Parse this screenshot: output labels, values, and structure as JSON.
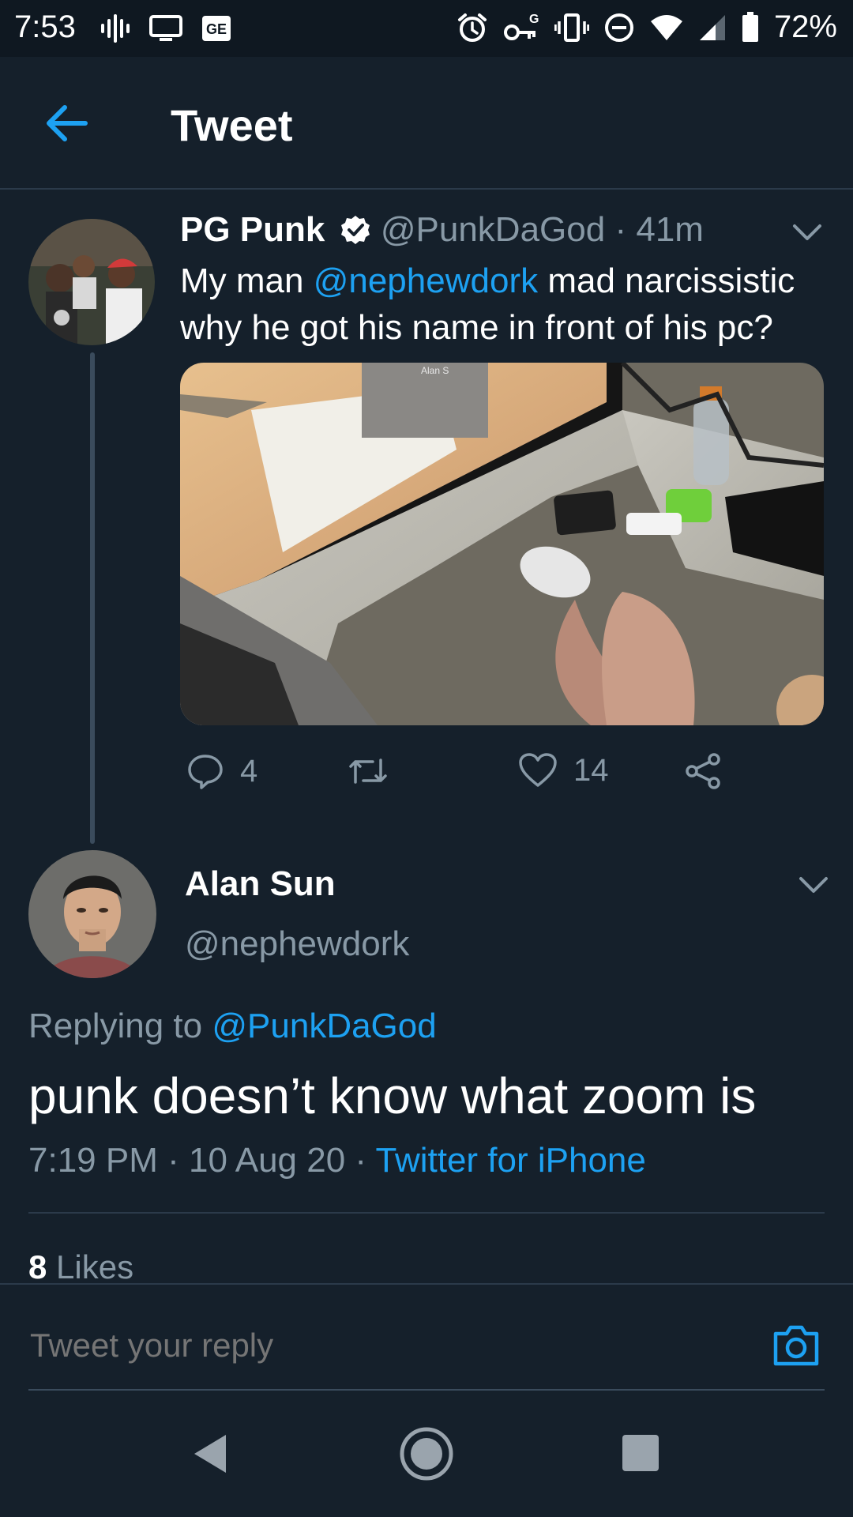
{
  "status_bar": {
    "time": "7:53",
    "battery": "72%",
    "icons_left": [
      "podcast-icon",
      "cast-icon",
      "news-icon"
    ],
    "icons_right": [
      "alarm-icon",
      "vpn-key-icon",
      "vibrate-icon",
      "do-not-disturb-icon",
      "wifi-icon",
      "signal-icon",
      "battery-icon"
    ]
  },
  "app_bar": {
    "title": "Tweet",
    "back_icon": "back-arrow-icon"
  },
  "colors": {
    "background": "#15202b",
    "link": "#1da1f2",
    "muted": "#8899a6",
    "divider": "#2b3a4a"
  },
  "quoted_tweet": {
    "author_name": "PG Punk",
    "verified": true,
    "handle": "@PunkDaGod",
    "separator": "·",
    "time_ago": "41m",
    "text_before": "My man ",
    "mention": "@nephewdork",
    "text_after": " mad narcissistic why he got his name in front of his pc?",
    "media_watermark": "Alan S",
    "reply_count": "4",
    "retweet_count": "",
    "like_count": "14"
  },
  "main_tweet": {
    "author_name": "Alan Sun",
    "handle": "@nephewdork",
    "replying_label": "Replying to ",
    "replying_to": "@PunkDaGod",
    "text": "punk doesn’t know what zoom is",
    "time": "7:19 PM",
    "date": "10 Aug 20",
    "separator": " · ",
    "source": "Twitter for iPhone",
    "likes_count": "8",
    "likes_label": "Likes"
  },
  "reply_composer": {
    "placeholder": "Tweet your reply"
  }
}
